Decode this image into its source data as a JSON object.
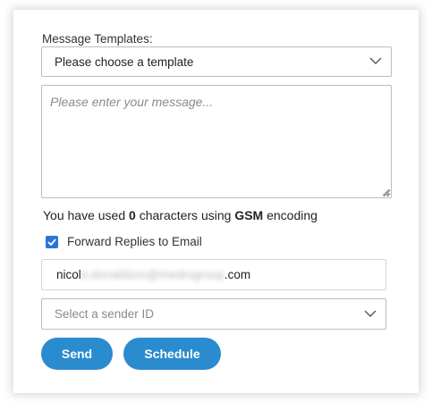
{
  "form": {
    "templates_label": "Message Templates:",
    "template_select_value": "Please choose a template",
    "message_placeholder": "Please enter your message...",
    "counter": {
      "prefix": "You have used",
      "count": "0",
      "middle": "characters using",
      "encoding": "GSM",
      "suffix": "encoding"
    },
    "forward_label": "Forward Replies to Email",
    "forward_checked": true,
    "email": {
      "prefix": "nicol",
      "redacted": "e.donaldson@medrogroup",
      "suffix": ".com"
    },
    "sender_placeholder": "Select a sender ID",
    "send_label": "Send",
    "schedule_label": "Schedule"
  },
  "colors": {
    "accent": "#2a8bcf",
    "checkbox": "#2a75d7",
    "border": "#bdbdbd"
  },
  "icons": {
    "dropdown": "chevron-down-icon",
    "checkbox": "checkmark-icon",
    "resize": "resize-grip-icon"
  }
}
